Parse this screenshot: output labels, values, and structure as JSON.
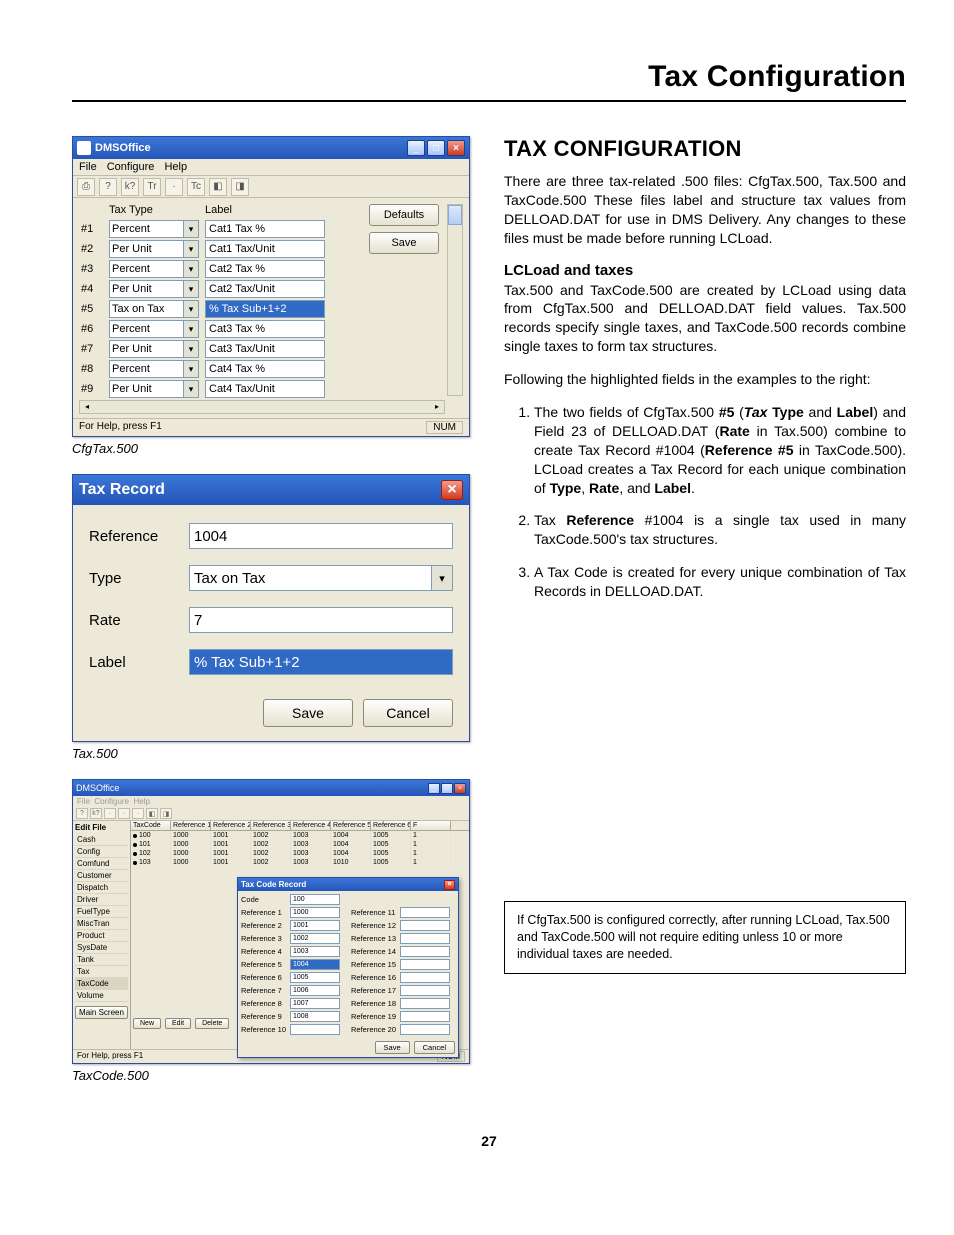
{
  "page": {
    "header": "Tax Configuration",
    "number": "27"
  },
  "captions": {
    "cfgtax": "CfgTax.500",
    "tax500": "Tax.500",
    "taxcode": "TaxCode.500"
  },
  "dmsoffice": {
    "title": "DMSOffice",
    "menu": {
      "file": "File",
      "configure": "Configure",
      "help": "Help"
    },
    "headers": {
      "taxtype": "Tax Type",
      "label": "Label"
    },
    "buttons": {
      "defaults": "Defaults",
      "save": "Save"
    },
    "rows": [
      {
        "num": "#1",
        "type": "Percent",
        "label": "Cat1 Tax %"
      },
      {
        "num": "#2",
        "type": "Per Unit",
        "label": "Cat1 Tax/Unit"
      },
      {
        "num": "#3",
        "type": "Percent",
        "label": "Cat2 Tax %"
      },
      {
        "num": "#4",
        "type": "Per Unit",
        "label": "Cat2 Tax/Unit"
      },
      {
        "num": "#5",
        "type": "Tax on Tax",
        "label": "% Tax Sub+1+2",
        "hl": true
      },
      {
        "num": "#6",
        "type": "Percent",
        "label": "Cat3 Tax %"
      },
      {
        "num": "#7",
        "type": "Per Unit",
        "label": "Cat3 Tax/Unit"
      },
      {
        "num": "#8",
        "type": "Percent",
        "label": "Cat4 Tax %"
      },
      {
        "num": "#9",
        "type": "Per Unit",
        "label": "Cat4 Tax/Unit"
      }
    ],
    "status": {
      "help": "For Help, press F1",
      "num": "NUM"
    }
  },
  "taxrecord": {
    "title": "Tax Record",
    "labels": {
      "reference": "Reference",
      "type": "Type",
      "rate": "Rate",
      "label": "Label"
    },
    "values": {
      "reference": "1004",
      "type": "Tax on Tax",
      "rate": "7",
      "label": "% Tax Sub+1+2"
    },
    "buttons": {
      "save": "Save",
      "cancel": "Cancel"
    }
  },
  "taxcode": {
    "title": "DMSOffice",
    "editfile": "Edit File",
    "sidebar": [
      "Cash",
      "Config",
      "Comfund",
      "Customer",
      "Dispatch",
      "Driver",
      "FuelType",
      "MiscTran",
      "Product",
      "SysDate",
      "Tank",
      "Tax",
      "TaxCode",
      "Volume"
    ],
    "mainscreen": "Main Screen",
    "gridhead": [
      "TaxCode",
      "Reference 1",
      "Reference 2",
      "Reference 3",
      "Reference 4",
      "Reference 5",
      "Reference 6",
      "F"
    ],
    "gridrows": [
      [
        "100",
        "1000",
        "1001",
        "1002",
        "1003",
        "1004",
        "1005",
        "1"
      ],
      [
        "101",
        "1000",
        "1001",
        "1002",
        "1003",
        "1004",
        "1005",
        "1"
      ],
      [
        "102",
        "1000",
        "1001",
        "1002",
        "1003",
        "1004",
        "1005",
        "1"
      ],
      [
        "103",
        "1000",
        "1001",
        "1002",
        "1003",
        "1010",
        "1005",
        "1"
      ]
    ],
    "rowbtns": {
      "new": "New",
      "edit": "Edit",
      "delete": "Delete"
    },
    "subdialog": {
      "title": "Tax Code Record",
      "code_label": "Code",
      "code_value": "100",
      "left": [
        {
          "l": "Reference 1",
          "v": "1000"
        },
        {
          "l": "Reference 2",
          "v": "1001"
        },
        {
          "l": "Reference 3",
          "v": "1002"
        },
        {
          "l": "Reference 4",
          "v": "1003"
        },
        {
          "l": "Reference 5",
          "v": "1004",
          "hl": true
        },
        {
          "l": "Reference 6",
          "v": "1005"
        },
        {
          "l": "Reference 7",
          "v": "1006"
        },
        {
          "l": "Reference 8",
          "v": "1007"
        },
        {
          "l": "Reference 9",
          "v": "1008"
        },
        {
          "l": "Reference 10",
          "v": ""
        }
      ],
      "right": [
        {
          "l": "Reference 11",
          "v": ""
        },
        {
          "l": "Reference 12",
          "v": ""
        },
        {
          "l": "Reference 13",
          "v": ""
        },
        {
          "l": "Reference 14",
          "v": ""
        },
        {
          "l": "Reference 15",
          "v": ""
        },
        {
          "l": "Reference 16",
          "v": ""
        },
        {
          "l": "Reference 17",
          "v": ""
        },
        {
          "l": "Reference 18",
          "v": ""
        },
        {
          "l": "Reference 19",
          "v": ""
        },
        {
          "l": "Reference 20",
          "v": ""
        }
      ],
      "buttons": {
        "save": "Save",
        "cancel": "Cancel"
      }
    },
    "status": {
      "help": "For Help, press F1",
      "num": "NUM"
    }
  },
  "article": {
    "h1": "TAX CONFIGURATION",
    "p1": "There are three tax-related .500 files: CfgTax.500, Tax.500 and TaxCode.500 These files label and structure tax values from DELLOAD.DAT for use in DMS Delivery. Any changes to these files must be made before running LCLoad.",
    "h2": "LCLoad and taxes",
    "p2": "Tax.500 and TaxCode.500 are created by LCLoad using data from CfgTax.500 and DELLOAD.DAT field values. Tax.500 records specify single taxes, and TaxCode.500 records combine single taxes to form tax structures.",
    "p3": "Following the highlighted fields in the examples to the right:",
    "li1a": "The two fields of CfgTax.500 ",
    "li1b": "#5",
    "li1c": " (",
    "li1d": "Tax",
    "li1e": " ",
    "li1f": "Type",
    "li1g": " and ",
    "li1h": "Label",
    "li1i": ") and Field 23 of DELLOAD.DAT (",
    "li1j": "Rate",
    "li1k": " in Tax.500) combine to create Tax Record #1004  (",
    "li1l": "Reference #5",
    "li1m": " in TaxCode.500). LCLoad creates a Tax Record for each unique combination of ",
    "li1n": "Type",
    "li1o": ", ",
    "li1p": "Rate",
    "li1q": ", and ",
    "li1r": "Label",
    "li1s": ".",
    "li2a": "Tax ",
    "li2b": "Reference",
    "li2c": " #1004 is a single tax used in many TaxCode.500's tax structures.",
    "li3": "A Tax Code is created for every unique combination of Tax Records in DELLOAD.DAT.",
    "note": "If CfgTax.500 is configured correctly, after running LCLoad, Tax.500 and TaxCode.500 will not require editing unless 10 or more individual taxes are needed."
  }
}
